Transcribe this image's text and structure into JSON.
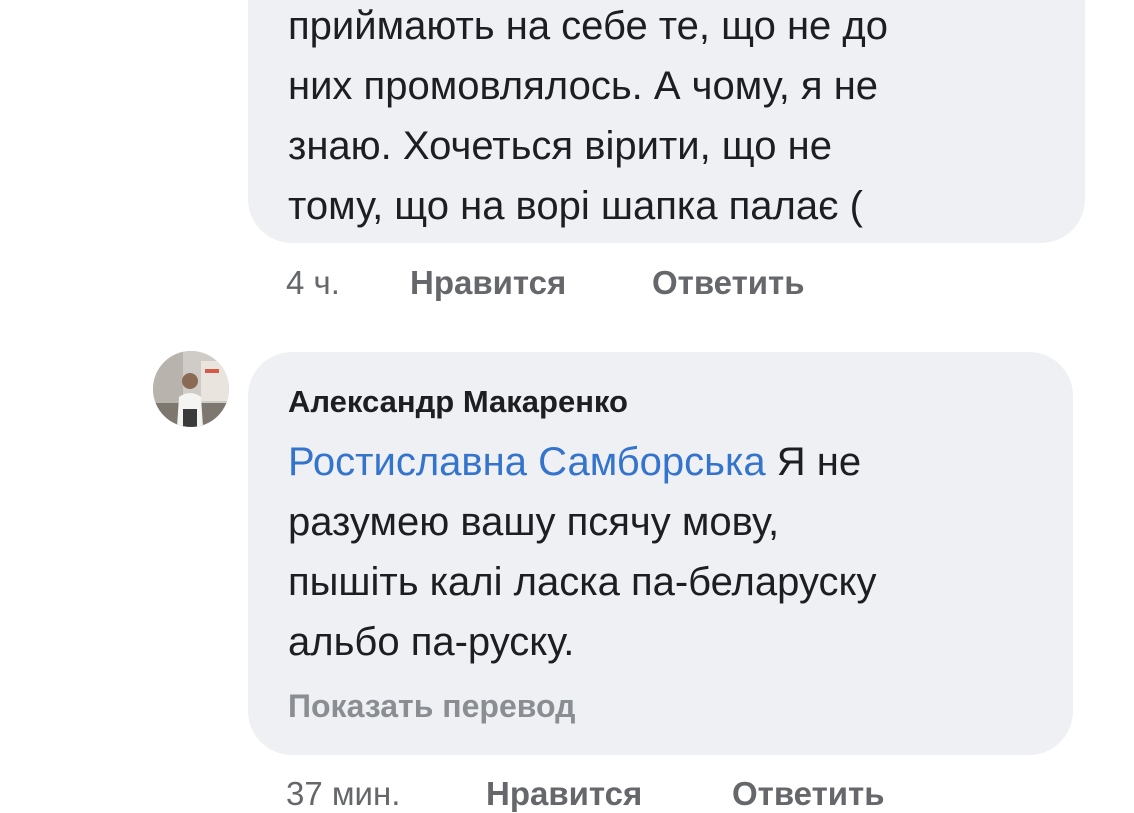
{
  "comment1": {
    "lines": [
      "приймають на себе те, що не до",
      "них промовлялось. А чому, я не",
      "знаю. Хочеться вірити, що не",
      "тому, що на ворі шапка палає ("
    ],
    "time": "4 ч.",
    "like_label": "Нравится",
    "reply_label": "Ответить"
  },
  "comment2": {
    "author": "Александр Макаренко",
    "mention": "Ростиславна Самборська",
    "first_line_rest": " Я не",
    "lines": [
      "разумею вашу псячу мову,",
      "пышіть калі ласка па-беларуску",
      "альбо па-руску."
    ],
    "translate_label": "Показать перевод",
    "time": "37 мин.",
    "like_label": "Нравится",
    "reply_label": "Ответить"
  },
  "colors": {
    "bubble": "#eef0f4",
    "mention": "#3474cd",
    "meta": "#65676b",
    "translate": "#8a8d91"
  }
}
